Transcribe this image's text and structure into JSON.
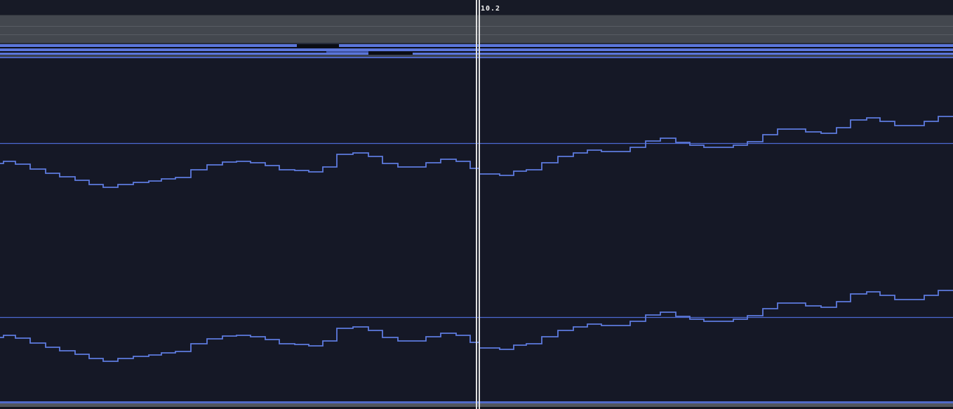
{
  "playhead": {
    "label": "10.2",
    "x": 678,
    "color": "#dfdfdf"
  },
  "colors": {
    "canvas_bg": "#151826",
    "ruler_bg": "#171a26",
    "header_rows_bg": "#43474e",
    "region_blue": "#5b76db",
    "reference_line": "#4c69d2",
    "envelope_line": "#5d7ade",
    "playhead": "#dfdfdf"
  },
  "tracks_strip": {
    "region_gaps": [
      {
        "band": "blue1",
        "x": 423,
        "w": 60,
        "kind": "dark"
      },
      {
        "band": "gap2",
        "x": 465,
        "w": 60,
        "kind": "blue"
      },
      {
        "band": "blue3",
        "x": 525,
        "w": 63,
        "kind": "dark"
      }
    ]
  },
  "chart_data": {
    "type": "line",
    "mode": "step-after",
    "title": "",
    "xlabel": "",
    "ylabel": "",
    "x_range": [
      0,
      1358
    ],
    "grid": false,
    "legend": "none",
    "description": "Two identical step-automation envelope lanes drawn in screen pixels; each lane has a horizontal zero-reference line.",
    "lanes": [
      {
        "name": "envelope-lane-top",
        "reference_y": 204.5,
        "offset": 0
      },
      {
        "name": "envelope-lane-bottom",
        "reference_y": 452.5,
        "offset": 248
      }
    ],
    "steps": {
      "x": [
        0,
        5,
        22,
        43,
        65,
        85,
        107,
        127,
        147,
        168,
        190,
        212,
        230,
        250,
        272,
        295,
        317,
        337,
        357,
        378,
        398,
        420,
        440,
        460,
        480,
        503,
        525,
        545,
        567,
        607,
        628,
        650,
        670,
        683,
        712,
        732,
        750,
        772,
        795,
        817,
        837,
        857,
        898,
        920,
        941,
        963,
        983,
        1003,
        1045,
        1065,
        1087,
        1108,
        1148,
        1170,
        1192,
        1212,
        1235,
        1254,
        1275,
        1317,
        1337
      ],
      "y": [
        233,
        230,
        234,
        241,
        247,
        252,
        257,
        263,
        267,
        263,
        260,
        258,
        255,
        253,
        242,
        235,
        231,
        230,
        232,
        236,
        242,
        243,
        245,
        238,
        220,
        218,
        223,
        233,
        238,
        232,
        227,
        230,
        240,
        248,
        250,
        244,
        242,
        232,
        223,
        218,
        214,
        216,
        210,
        201,
        197,
        203,
        207,
        210,
        207,
        202,
        192,
        184,
        188,
        190,
        182,
        171,
        168,
        173,
        179,
        173,
        166
      ],
      "end_x": 1358
    }
  }
}
